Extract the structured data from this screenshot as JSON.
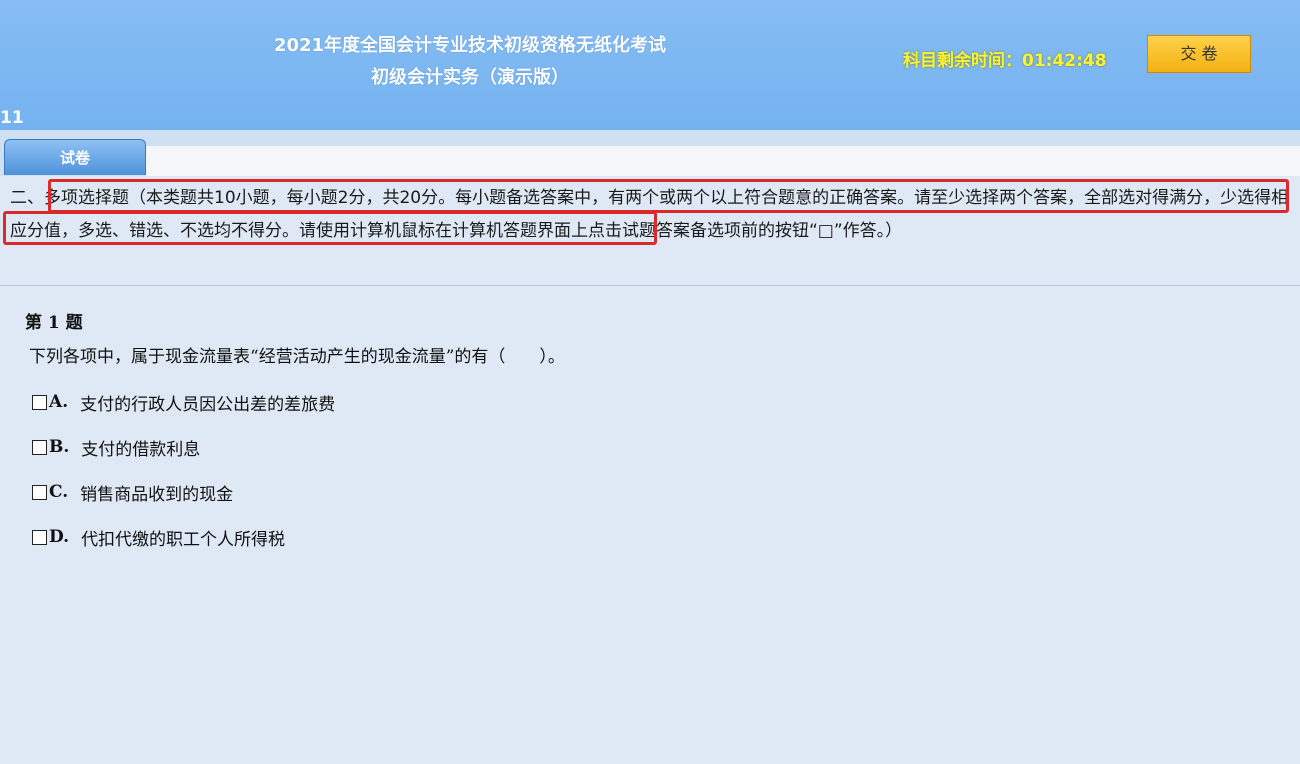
{
  "header": {
    "title_line1": "2021年度全国会计专业技术初级资格无纸化考试",
    "title_line2": "初级会计实务（演示版）",
    "timer_label": "科目剩余时间：",
    "timer_value": "01:42:48",
    "submit_label": "交 卷",
    "id_label": "11"
  },
  "tabs": [
    {
      "label": "试卷",
      "active": true
    }
  ],
  "instruction": {
    "prefix": "二、",
    "highlight1": "多项选择题（本类题共10小题，每小题2分，共20分。每小题备选答案中，有两个或两个以上符合题意的正确答案。请至少选择两个答",
    "highlight2": "案，全部选对得满分，少选得相应分值，多选、错选、不选均不得分。",
    "rest": "请使用计算机鼠标在计算机答题界面上点击试题答案备选项前的按钮“□”作答。）"
  },
  "question": {
    "number_label": "第 1 题",
    "stem": "下列各项中，属于现金流量表“经营活动产生的现金流量”的有（　　）。",
    "options": [
      {
        "letter": "A.",
        "text": "支付的行政人员因公出差的差旅费"
      },
      {
        "letter": "B.",
        "text": "支付的借款利息"
      },
      {
        "letter": "C.",
        "text": "销售商品收到的现金"
      },
      {
        "letter": "D.",
        "text": "代扣代缴的职工个人所得税"
      }
    ]
  },
  "colors": {
    "header_bg": "#7cb8f2",
    "timer_text": "#f6f43a",
    "submit_bg": "#f7bf2a",
    "highlight_border": "#d92b2b",
    "page_bg": "#dfe9f5"
  }
}
